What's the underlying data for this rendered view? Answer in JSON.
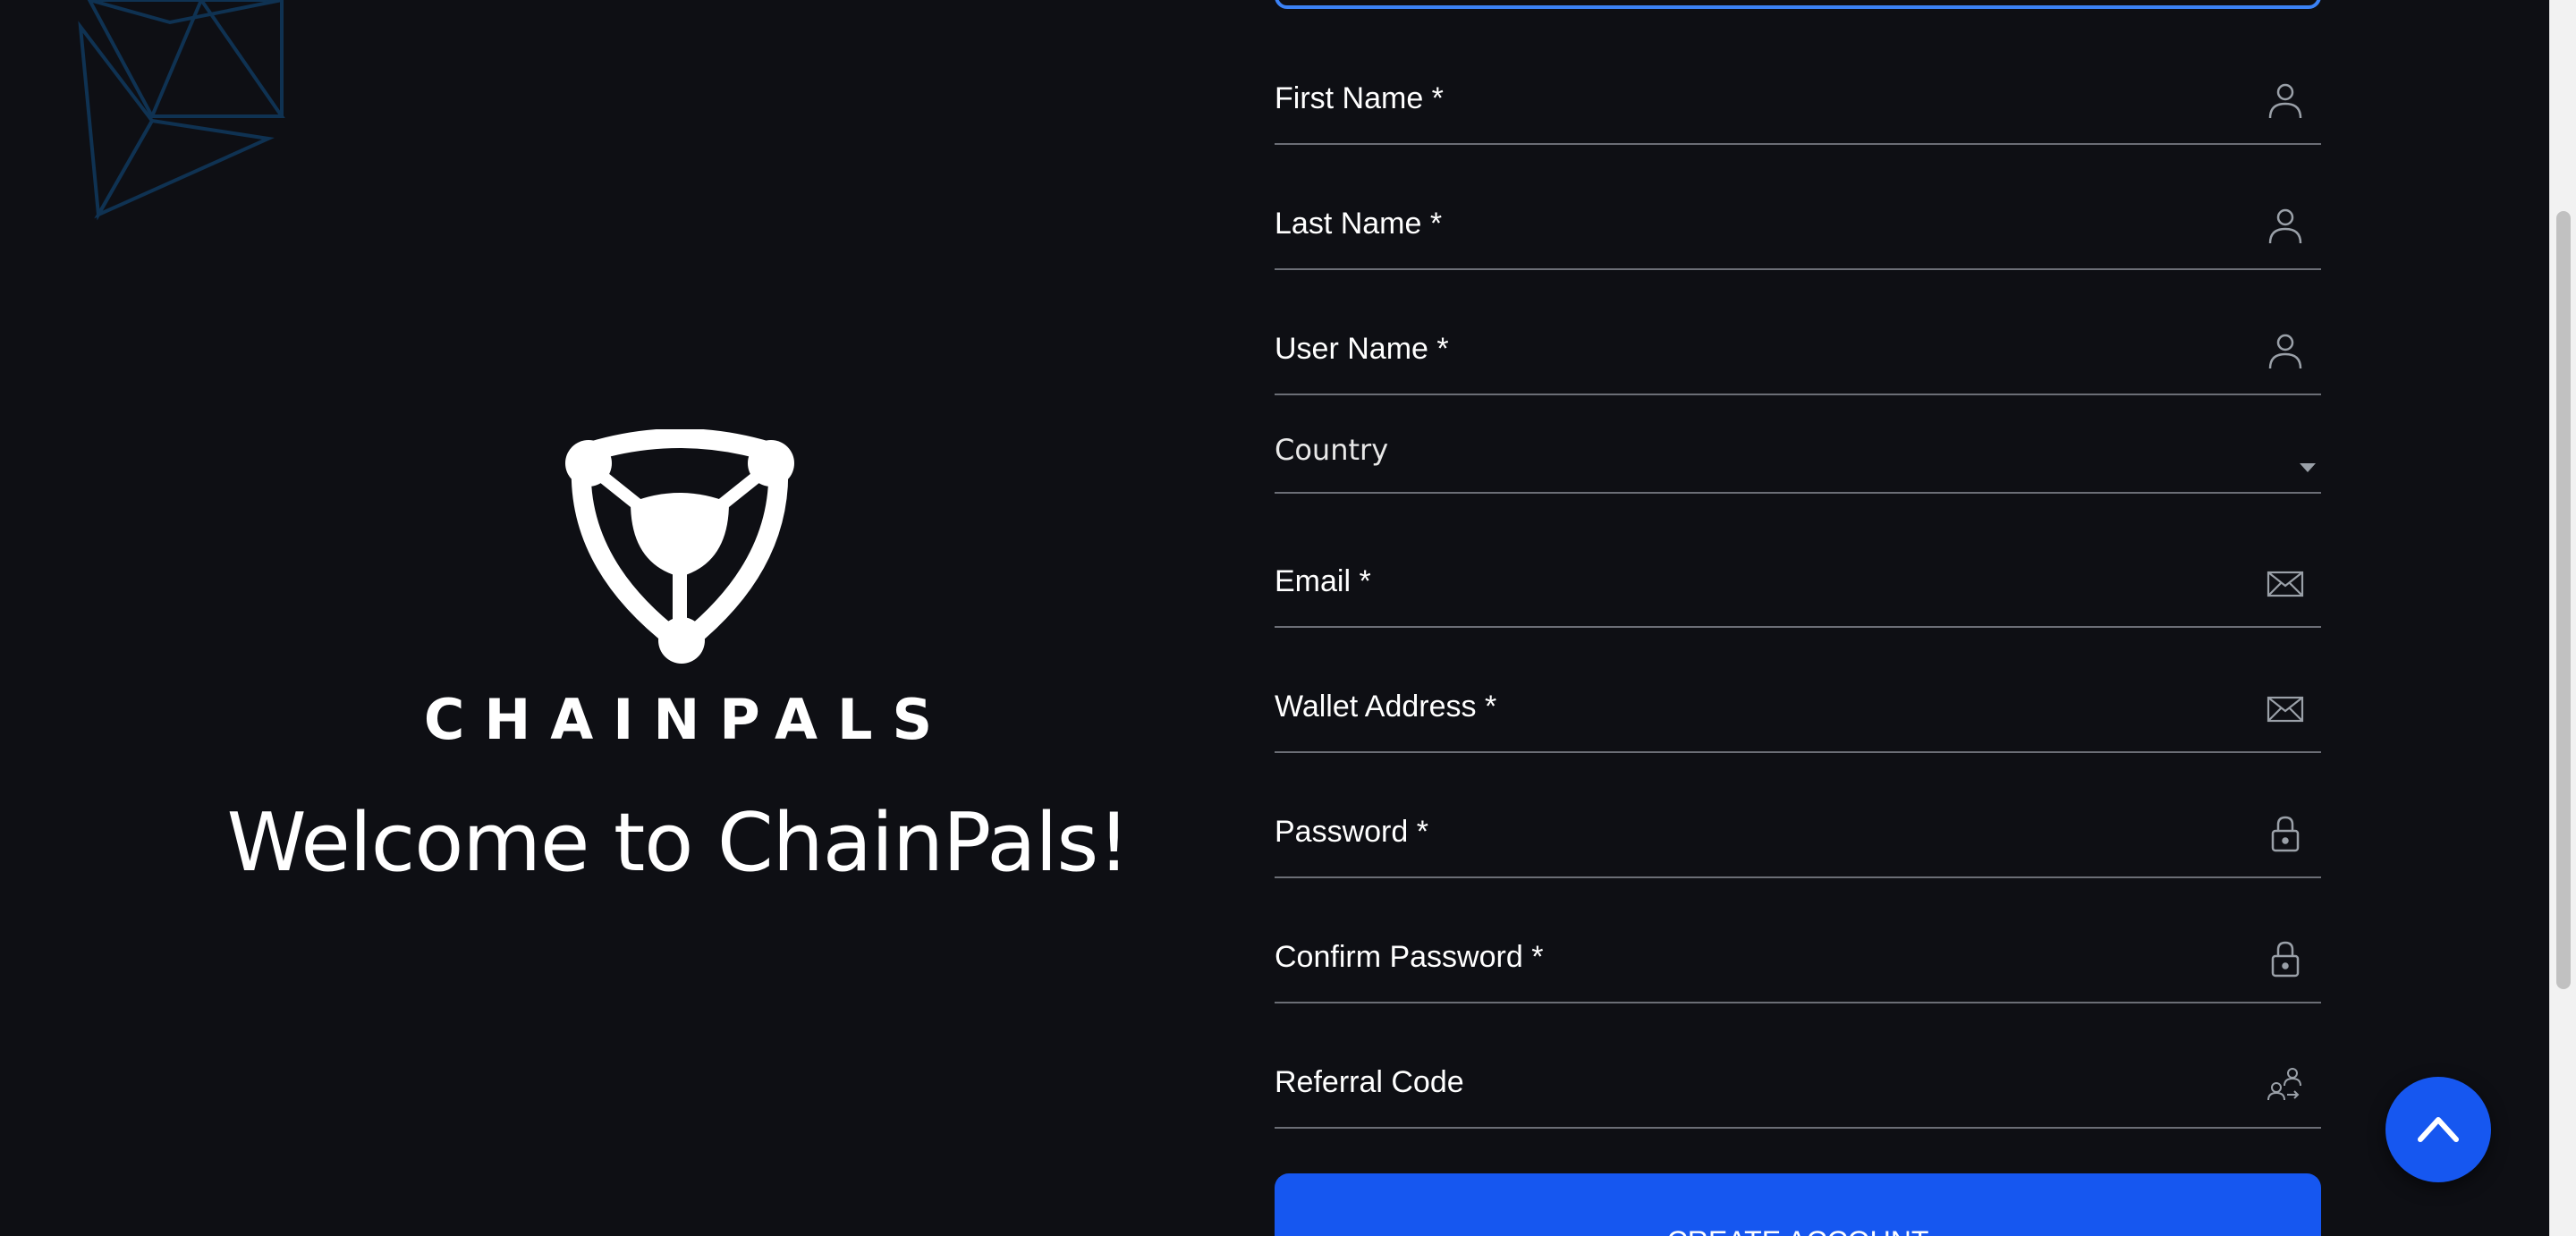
{
  "brand": {
    "wordmark": "CHAINPALS",
    "welcome": "Welcome to ChainPals!"
  },
  "form": {
    "fields": [
      {
        "label": "First Name *",
        "icon": "user-icon"
      },
      {
        "label": "Last Name *",
        "icon": "user-icon"
      },
      {
        "label": "User Name *",
        "icon": "user-icon"
      },
      {
        "label": "Country",
        "icon": "chevron-down-icon"
      },
      {
        "label": "Email *",
        "icon": "envelope-icon"
      },
      {
        "label": "Wallet Address *",
        "icon": "envelope-icon"
      },
      {
        "label": "Password *",
        "icon": "lock-icon"
      },
      {
        "label": "Confirm Password *",
        "icon": "lock-icon"
      },
      {
        "label": "Referral Code",
        "icon": "referral-icon"
      }
    ],
    "submit_label": "CREATE ACCOUNT"
  },
  "colors": {
    "background": "#0e0f14",
    "accent": "#1657f0",
    "focus_border": "#3b82f6"
  }
}
